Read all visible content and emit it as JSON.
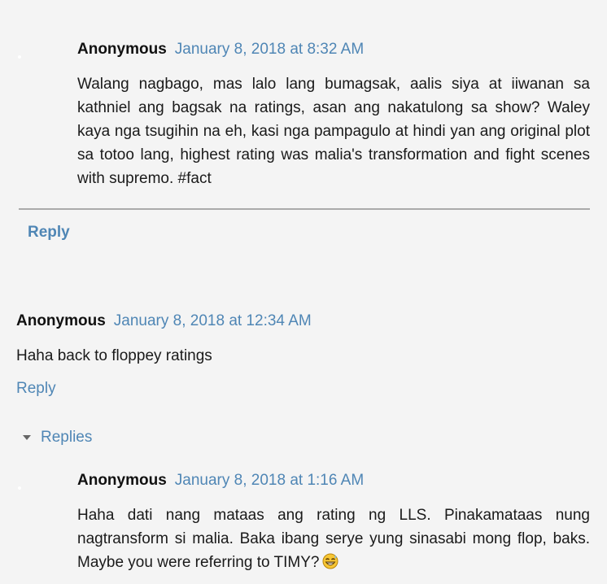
{
  "comments": [
    {
      "author": "Anonymous",
      "date": "January 8, 2018 at 8:32 AM",
      "text": "Walang nagbago, mas lalo lang bumagsak, aalis siya at iiwanan sa kathniel ang bagsak na ratings, asan ang nakatulong sa show? Waley kaya nga tsugihin na eh, kasi nga pampagulo at hindi yan ang original plot sa totoo lang, highest rating was malia's transformation and fight scenes with supremo. #fact"
    },
    {
      "author": "Anonymous",
      "date": "January 8, 2018 at 12:34 AM",
      "text": "Haha back to floppey ratings"
    },
    {
      "author": "Anonymous",
      "date": "January 8, 2018 at 1:16 AM",
      "text": "Haha dati nang mataas ang rating ng LLS. Pinakamataas nung nagtransform si malia. Baka ibang serye yung sinasabi mong flop, baks. Maybe you were referring to TIMY?",
      "emoji_icon": "grinning-sweat-emoji-icon"
    }
  ],
  "thread_reply_label": "Reply",
  "comment_reply_label": "Reply",
  "replies_label": "Replies",
  "colors": {
    "background": "#f4f4f4",
    "link": "#4f86b5",
    "text": "#1a1a1a",
    "divider": "#aaaaaa"
  }
}
